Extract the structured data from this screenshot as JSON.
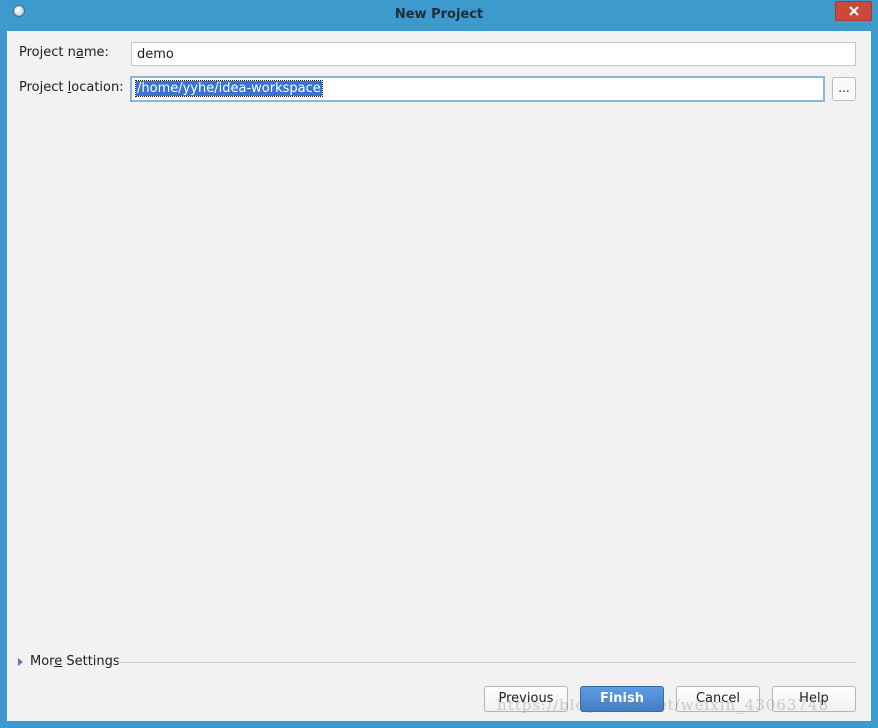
{
  "window": {
    "title": "New Project",
    "accent_color": "#3d9acd",
    "close_color": "#c94a3b",
    "app_icon": "app-icon",
    "close_icon": "close-icon"
  },
  "form": {
    "project_name": {
      "label_prefix": "Project n",
      "label_mnemonic": "a",
      "label_suffix": "me:",
      "value": "demo"
    },
    "project_location": {
      "label_prefix": "Project ",
      "label_mnemonic": "l",
      "label_suffix": "ocation:",
      "value": "/home/yyhe/idea-workspace",
      "selection_color": "#3873d4"
    },
    "browse_label": "..."
  },
  "more_settings": {
    "label_prefix": "Mor",
    "label_mnemonic": "e",
    "label_suffix": " Settings",
    "icon": "expand-triangle-icon"
  },
  "buttons": {
    "previous": "Previous",
    "finish": "Finish",
    "cancel": "Cancel",
    "help": "Help"
  },
  "watermark": "https://blog.csdn.net/weixin_43063748"
}
